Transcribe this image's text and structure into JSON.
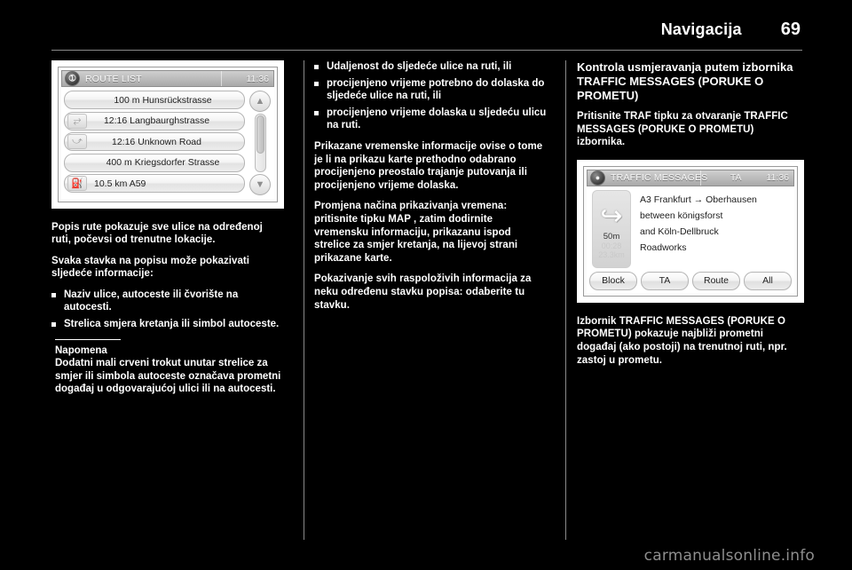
{
  "header": {
    "title": "Navigacija",
    "page_number": "69"
  },
  "watermark": "carmanualsonline.info",
  "route_list_screen": {
    "badge_icon": "info-icon",
    "title": "ROUTE LIST",
    "clock": "11:36",
    "rows": [
      {
        "icon": "",
        "label": "100 m Hunsrückstrasse"
      },
      {
        "icon": "turn-right-icon",
        "label": "12:16 Langbaurghstrasse"
      },
      {
        "icon": "turn-slight-icon",
        "label": "12:16 Unknown Road"
      },
      {
        "icon": "",
        "label": "400 m Kriegsdorfer Strasse"
      },
      {
        "icon": "motorway-icon",
        "label": "10.5 km A59"
      }
    ],
    "scroll_up_icon": "chevron-up-icon",
    "scroll_down_icon": "chevron-down-icon"
  },
  "col1": {
    "p1": "Popis rute pokazuje sve ulice na određenoj ruti, počevsi od trenutne lokacije.",
    "p2": "Svaka stavka na popisu može pokazivati sljedeće informacije:",
    "bullets": [
      "Naziv ulice, autoceste ili čvorište na autocesti.",
      "Strelica smjera kretanja ili simbol autoceste."
    ],
    "note_title": "Napomena",
    "note_text": "Dodatni mali crveni trokut unutar strelice za smjer ili simbola autoceste označava prometni događaj u odgovarajućoj ulici ili na autocesti."
  },
  "col2": {
    "bullets": [
      "Udaljenost do sljedeće ulice na ruti, ili",
      "procijenjeno vrijeme potrebno do dolaska do sljedeće ulice na ruti, ili",
      "procijenjeno vrijeme dolaska u sljedeću ulicu na ruti."
    ],
    "p1": "Prikazane vremenske informacije ovise o tome je li na prikazu karte prethodno odabrano procijenjeno preostalo trajanje putovanja ili procijenjeno vrijeme dolaska.",
    "p2": "Promjena načina prikazivanja vremena: pritisnite tipku MAP , zatim dodirnite vremensku informaciju, prikazanu ispod strelice za smjer kretanja, na lijevoj strani prikazane karte.",
    "p3": "Pokazivanje svih raspoloživih informacija za neku određenu stavku popisa: odaberite tu stavku."
  },
  "col3": {
    "section_title": "Kontrola usmjeravanja putem izbornika TRAFFIC MESSAGES (PORUKE O PROMETU)",
    "p1": "Pritisnite TRAF tipku za otvaranje TRAFFIC MESSAGES (PORUKE O PROMETU) izbornika.",
    "p2": "Izbornik TRAFFIC MESSAGES (PORUKE O PROMETU) pokazuje najbliži prometni događaj (ako postoji) na trenutnoj ruti, npr. zastoj u prometu."
  },
  "traffic_screen": {
    "badge_icon": "traffic-icon",
    "title": "TRAFFIC MESSAGES",
    "ta_label": "TA",
    "clock": "11:36",
    "arrow_icon": "turn-right-arrow-icon",
    "distance": "50m",
    "eta_time": "00:28",
    "eta_distance": "23.3km",
    "message_lines": [
      "A3 Frankfurt → Oberhausen",
      "between königsforst",
      "and Köln-Dellbruck",
      "Roadworks"
    ],
    "buttons": [
      "Block",
      "TA",
      "Route",
      "All"
    ]
  }
}
